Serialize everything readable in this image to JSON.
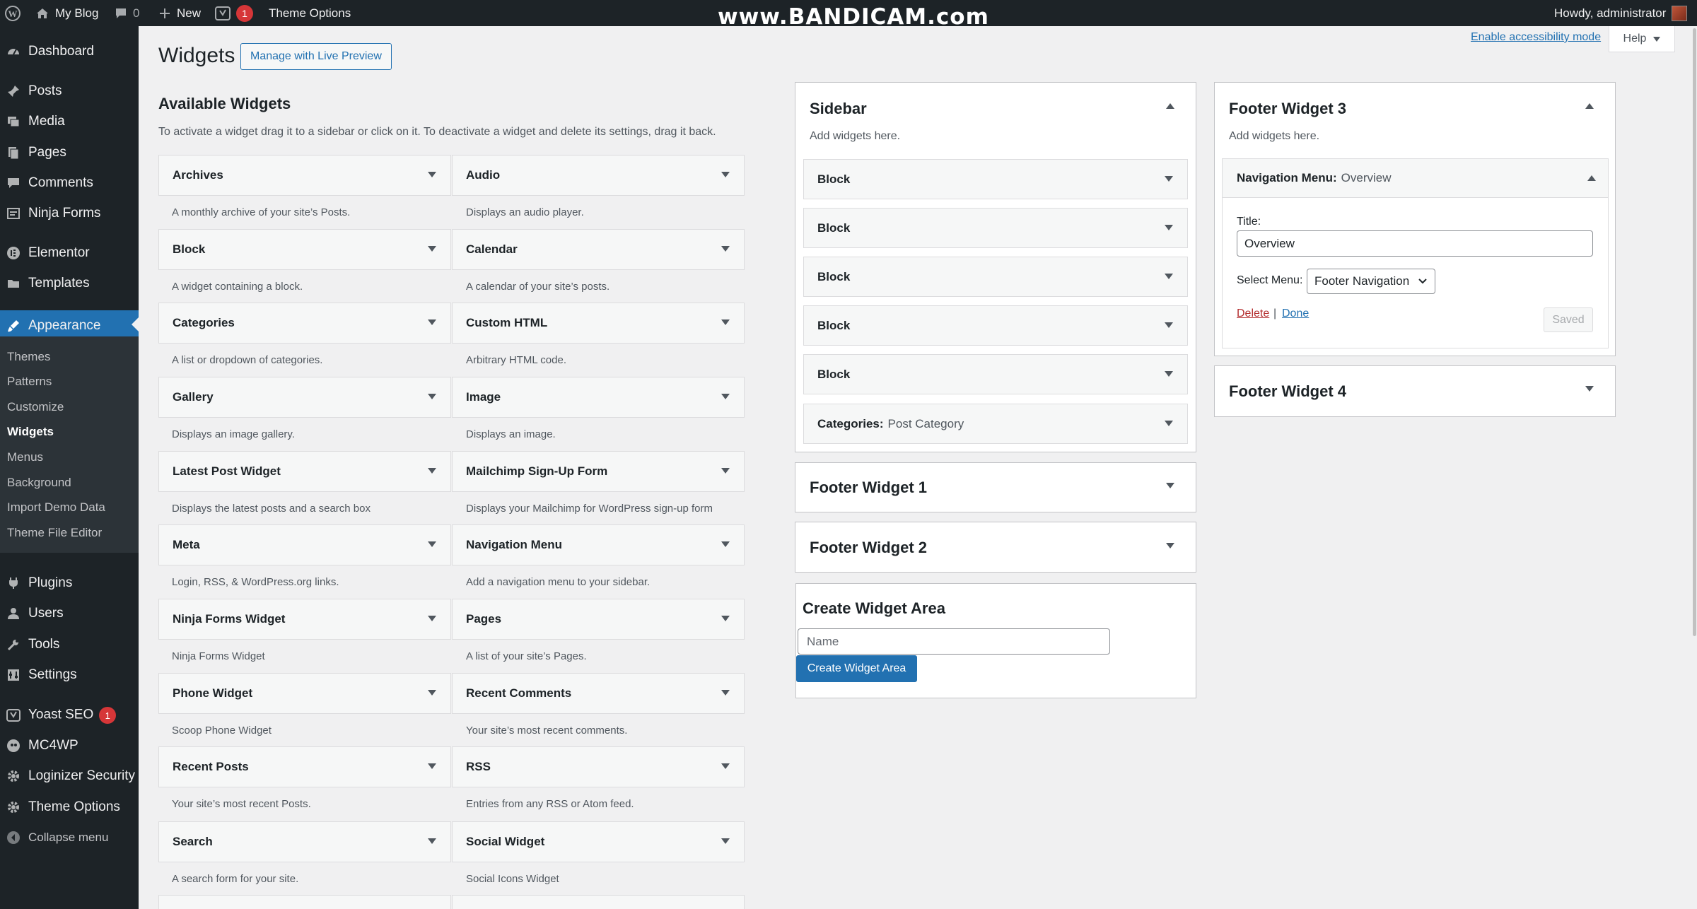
{
  "adminbar": {
    "site_name": "My Blog",
    "comments_count": "0",
    "new_label": "New",
    "yoast_count": "1",
    "theme_options": "Theme Options",
    "watermark": "www.BANDICAM.com",
    "howdy": "Howdy, administrator"
  },
  "menu": {
    "dashboard": "Dashboard",
    "posts": "Posts",
    "media": "Media",
    "pages": "Pages",
    "comments": "Comments",
    "ninja_forms": "Ninja Forms",
    "elementor": "Elementor",
    "templates": "Templates",
    "appearance": "Appearance",
    "submenu": [
      "Themes",
      "Patterns",
      "Customize",
      "Widgets",
      "Menus",
      "Background",
      "Import Demo Data",
      "Theme File Editor"
    ],
    "plugins": "Plugins",
    "users": "Users",
    "tools": "Tools",
    "settings": "Settings",
    "yoast": "Yoast SEO",
    "yoast_badge": "1",
    "mc4wp": "MC4WP",
    "loginizer": "Loginizer Security",
    "theme_options": "Theme Options",
    "collapse": "Collapse menu"
  },
  "header": {
    "title": "Widgets",
    "live_preview": "Manage with Live Preview",
    "accessibility": "Enable accessibility mode",
    "help": "Help"
  },
  "available": {
    "title": "Available Widgets",
    "description": "To activate a widget drag it to a sidebar or click on it. To deactivate a widget and delete its settings, drag it back.",
    "left": [
      {
        "name": "Archives",
        "desc": "A monthly archive of your site’s Posts."
      },
      {
        "name": "Block",
        "desc": "A widget containing a block."
      },
      {
        "name": "Categories",
        "desc": "A list or dropdown of categories."
      },
      {
        "name": "Gallery",
        "desc": "Displays an image gallery."
      },
      {
        "name": "Latest Post Widget",
        "desc": "Displays the latest posts and a search box"
      },
      {
        "name": "Meta",
        "desc": "Login, RSS, & WordPress.org links."
      },
      {
        "name": "Ninja Forms Widget",
        "desc": "Ninja Forms Widget"
      },
      {
        "name": "Phone Widget",
        "desc": "Scoop Phone Widget"
      },
      {
        "name": "Recent Posts",
        "desc": "Your site’s most recent Posts."
      },
      {
        "name": "Search",
        "desc": "A search form for your site."
      }
    ],
    "right": [
      {
        "name": "Audio",
        "desc": "Displays an audio player."
      },
      {
        "name": "Calendar",
        "desc": "A calendar of your site’s posts."
      },
      {
        "name": "Custom HTML",
        "desc": "Arbitrary HTML code."
      },
      {
        "name": "Image",
        "desc": "Displays an image."
      },
      {
        "name": "Mailchimp Sign-Up Form",
        "desc": "Displays your Mailchimp for WordPress sign-up form"
      },
      {
        "name": "Navigation Menu",
        "desc": "Add a navigation menu to your sidebar."
      },
      {
        "name": "Pages",
        "desc": "A list of your site’s Pages."
      },
      {
        "name": "Recent Comments",
        "desc": "Your site’s most recent comments."
      },
      {
        "name": "RSS",
        "desc": "Entries from any RSS or Atom feed."
      },
      {
        "name": "Social Widget",
        "desc": "Social Icons Widget"
      }
    ]
  },
  "sidebar_area": {
    "title": "Sidebar",
    "subtitle": "Add widgets here.",
    "widgets": [
      {
        "name": "Block",
        "instance": ""
      },
      {
        "name": "Block",
        "instance": ""
      },
      {
        "name": "Block",
        "instance": ""
      },
      {
        "name": "Block",
        "instance": ""
      },
      {
        "name": "Block",
        "instance": ""
      },
      {
        "name": "Categories:",
        "instance": "Post Category"
      }
    ]
  },
  "footer1": {
    "title": "Footer Widget 1"
  },
  "footer2": {
    "title": "Footer Widget 2"
  },
  "footer3": {
    "title": "Footer Widget 3",
    "subtitle": "Add widgets here.",
    "nav_widget": {
      "name": "Navigation Menu:",
      "instance": "Overview",
      "title_label": "Title:",
      "title_value": "Overview",
      "menu_label": "Select Menu:",
      "menu_value": "Footer Navigation",
      "delete": "Delete",
      "separator": "|",
      "done": "Done",
      "saved": "Saved"
    }
  },
  "footer4": {
    "title": "Footer Widget 4"
  },
  "create": {
    "title": "Create Widget Area",
    "placeholder": "Name",
    "button": "Create Widget Area"
  }
}
